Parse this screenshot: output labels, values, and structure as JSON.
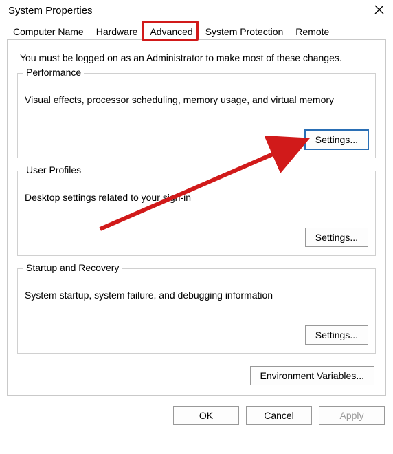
{
  "window": {
    "title": "System Properties"
  },
  "tabs": {
    "t0": "Computer Name",
    "t1": "Hardware",
    "t2": "Advanced",
    "t3": "System Protection",
    "t4": "Remote"
  },
  "intro": "You must be logged on as an Administrator to make most of these changes.",
  "performance": {
    "title": "Performance",
    "desc": "Visual effects, processor scheduling, memory usage, and virtual memory",
    "button": "Settings..."
  },
  "userprofiles": {
    "title": "User Profiles",
    "desc": "Desktop settings related to your sign-in",
    "button": "Settings..."
  },
  "startup": {
    "title": "Startup and Recovery",
    "desc": "System startup, system failure, and debugging information",
    "button": "Settings..."
  },
  "env_button": "Environment Variables...",
  "dlg": {
    "ok": "OK",
    "cancel": "Cancel",
    "apply": "Apply"
  },
  "annotation": {
    "highlight_tab": "Advanced",
    "arrow_target": "performance-settings-button"
  }
}
